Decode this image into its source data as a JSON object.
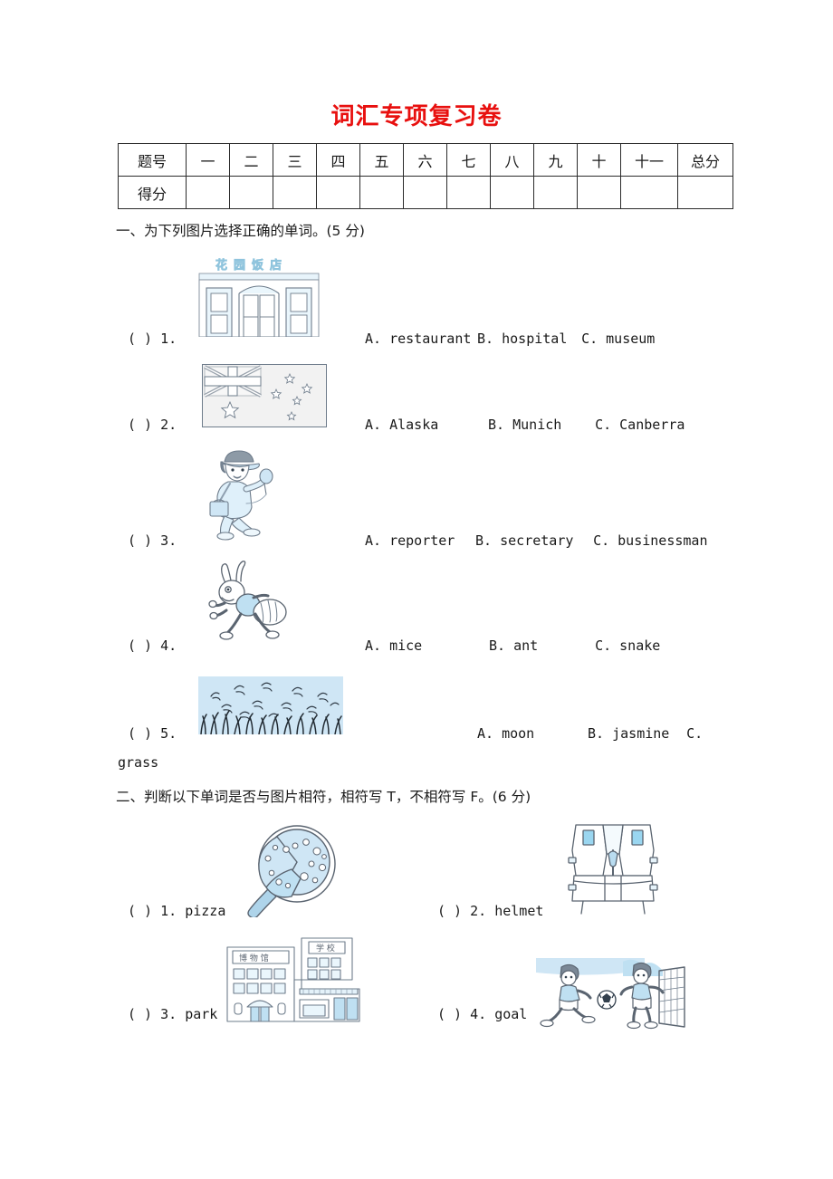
{
  "document": {
    "title": "词汇专项复习卷",
    "title_color": "#e8100f"
  },
  "score_table": {
    "row_labels": [
      "题号",
      "得分"
    ],
    "columns": [
      "一",
      "二",
      "三",
      "四",
      "五",
      "六",
      "七",
      "八",
      "九",
      "十",
      "十一",
      "总分"
    ],
    "score_values": [
      "",
      "",
      "",
      "",
      "",
      "",
      "",
      "",
      "",
      "",
      "",
      ""
    ]
  },
  "section_one": {
    "heading": "一、为下列图片选择正确的单词。(5 分)",
    "items": [
      {
        "bracket": "(    )",
        "number": "1.",
        "picture": "restaurant-building",
        "picture_sign_text": "花园饭店",
        "options": [
          "A. restaurant",
          "B. hospital",
          "C. museum"
        ]
      },
      {
        "bracket": "(    )",
        "number": "2.",
        "picture": "australian-flag",
        "options": [
          "A. Alaska",
          "B. Munich",
          "C. Canberra"
        ]
      },
      {
        "bracket": "(    )",
        "number": "3.",
        "picture": "reporter-with-microphone",
        "options": [
          "A. reporter",
          "B. secretary",
          "C. businessman"
        ]
      },
      {
        "bracket": "(    )",
        "number": "4.",
        "picture": "walking-ant",
        "options": [
          "A. mice",
          "B. ant",
          "C. snake"
        ]
      },
      {
        "bracket": "(    )",
        "number": "5.",
        "picture": "grass-field",
        "options": [
          "A. moon",
          "B. jasmine",
          "C."
        ],
        "wrapped_option": "grass"
      }
    ]
  },
  "section_two": {
    "heading": "二、判断以下单词是否与图片相符，相符写 T，不相符写 F。(6 分)",
    "items": [
      {
        "bracket": "(    )",
        "number": "1.",
        "word": "pizza",
        "picture": "pizza-in-pan"
      },
      {
        "bracket": "(    )",
        "number": "2.",
        "word": "helmet",
        "picture": "life-jacket-vest"
      },
      {
        "bracket": "(    )",
        "number": "3.",
        "word": "park",
        "picture": "museum-and-school-buildings",
        "picture_sign_texts": [
          "博 物 馆",
          "学 校"
        ]
      },
      {
        "bracket": "(    )",
        "number": "4.",
        "word": "goal",
        "picture": "boys-playing-soccer-goal"
      }
    ]
  },
  "colors": {
    "title_red": "#e8100f",
    "ink": "#1a1a1a",
    "illustration_line": "#5a6470",
    "illustration_fill": "#cfe6f5",
    "flag_gray": "#f0f0f0"
  }
}
